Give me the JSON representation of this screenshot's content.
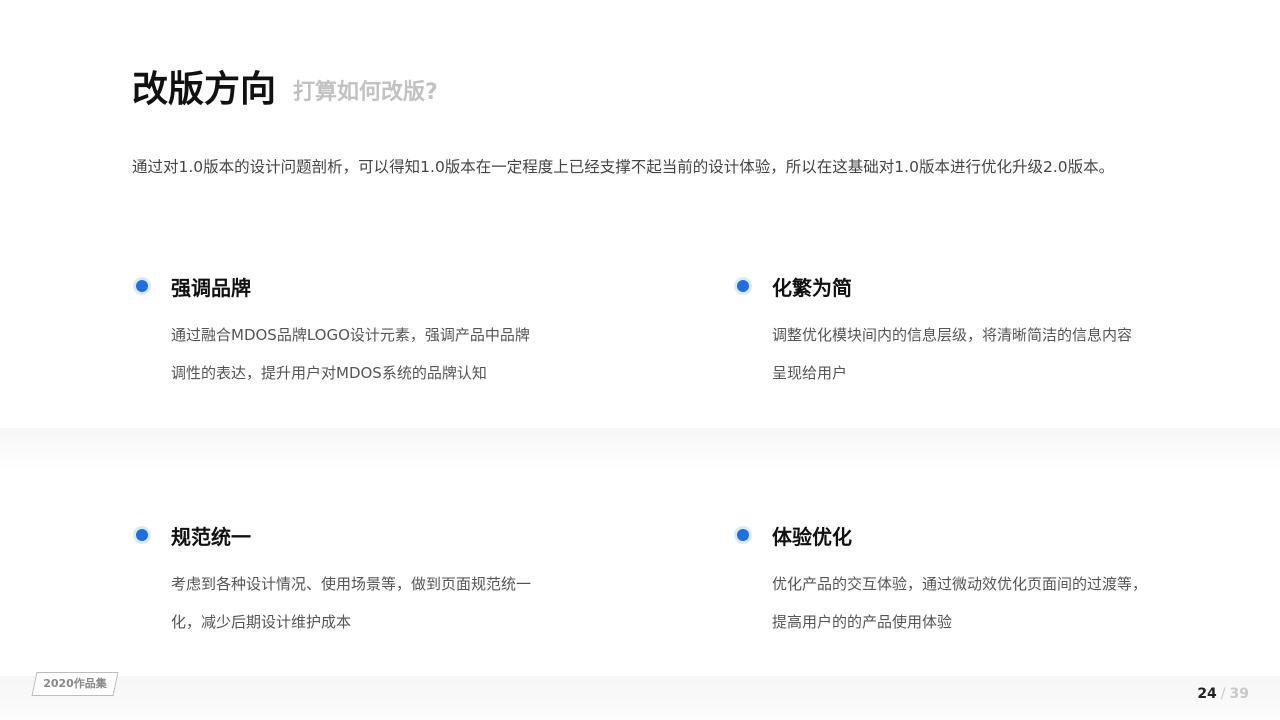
{
  "header": {
    "title": "改版方向",
    "subtitle": "打算如何改版?"
  },
  "intro": "通过对1.0版本的设计问题剖析，可以得知1.0版本在一定程度上已经支撑不起当前的设计体验，所以在这基础对1.0版本进行优化升级2.0版本。",
  "cards": [
    {
      "title": "强调品牌",
      "lines": [
        "通过融合MDOS品牌LOGO设计元素，强调产品中品牌",
        "调性的表达，提升用户对MDOS系统的品牌认知"
      ]
    },
    {
      "title": "化繁为简",
      "lines": [
        "调整优化模块间内的信息层级，将清晰简洁的信息内容",
        "呈现给用户"
      ]
    },
    {
      "title": "规范统一",
      "lines": [
        "考虑到各种设计情况、使用场景等，做到页面规范统一",
        "化，减少后期设计维护成本"
      ]
    },
    {
      "title": "体验优化",
      "lines": [
        "优化产品的交互体验，通过微动效优化页面间的过渡等，",
        "提高用户的的产品使用体验"
      ]
    }
  ],
  "footer": {
    "badge": "2020作品集",
    "page_current": "24",
    "page_separator": "/",
    "page_total": "39"
  },
  "colors": {
    "accent": "#1e6fe0",
    "title": "#111111",
    "subtitle": "#c2c2c2",
    "body_text": "#555555"
  }
}
